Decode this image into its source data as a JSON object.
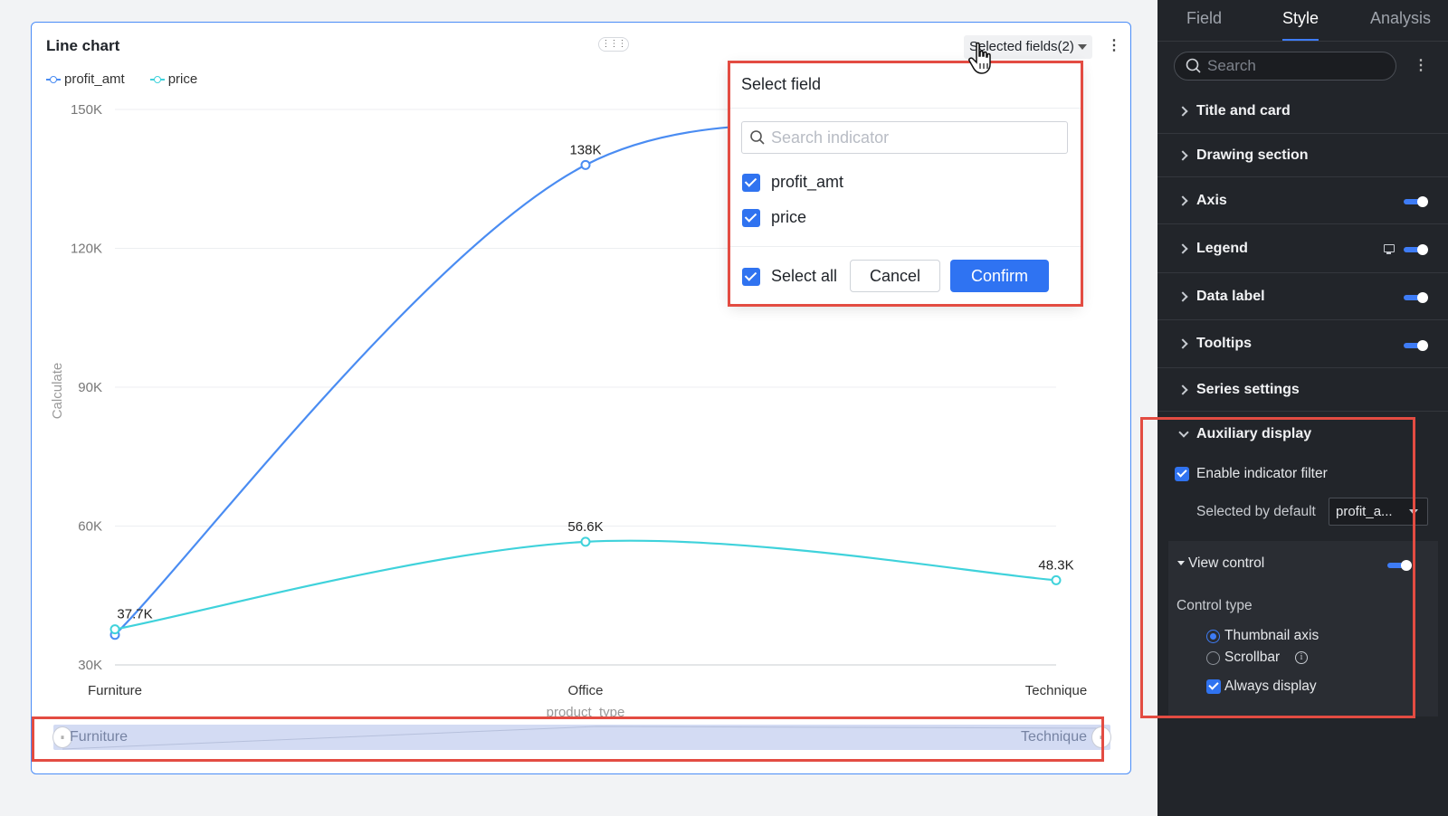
{
  "card": {
    "title": "Line chart",
    "selected_fields_label": "Selected fields(2)"
  },
  "chart_data": {
    "type": "line",
    "title": "Line chart",
    "xlabel": "product_type",
    "ylabel": "Calculate",
    "categories": [
      "Furniture",
      "Office",
      "Technique"
    ],
    "y_ticks": [
      "150K",
      "120K",
      "90K",
      "60K",
      "30K"
    ],
    "ylim": [
      30000,
      150000
    ],
    "legend_position": "top-left",
    "series": [
      {
        "name": "profit_amt",
        "color": "#4a8cf2",
        "values": [
          36500,
          138000,
          141500
        ],
        "labels": [
          null,
          "138K",
          null
        ]
      },
      {
        "name": "price",
        "color": "#3fd2db",
        "values": [
          37700,
          56600,
          48300
        ],
        "labels": [
          "37.7K",
          "56.6K",
          "48.3K"
        ]
      }
    ]
  },
  "thumbnail_axis": {
    "start_label": "Furniture",
    "end_label": "Technique"
  },
  "popover": {
    "title": "Select field",
    "search_placeholder": "Search indicator",
    "fields": [
      {
        "label": "profit_amt",
        "checked": true
      },
      {
        "label": "price",
        "checked": true
      }
    ],
    "select_all_label": "Select all",
    "cancel_label": "Cancel",
    "confirm_label": "Confirm"
  },
  "panel": {
    "tabs": [
      {
        "label": "Field",
        "active": false
      },
      {
        "label": "Style",
        "active": true
      },
      {
        "label": "Analysis",
        "active": false
      }
    ],
    "search_placeholder": "Search",
    "sections": [
      {
        "label": "Title and card",
        "toggle": false
      },
      {
        "label": "Drawing section",
        "toggle": false
      },
      {
        "label": "Axis",
        "toggle": true
      },
      {
        "label": "Legend",
        "toggle": true,
        "icon": "monitor-icon"
      },
      {
        "label": "Data label",
        "toggle": true
      },
      {
        "label": "Tooltips",
        "toggle": true
      },
      {
        "label": "Series settings",
        "toggle": false
      }
    ],
    "auxiliary": {
      "title": "Auxiliary display",
      "enable_filter_label": "Enable indicator filter",
      "selected_by_default_label": "Selected by default",
      "selected_by_default_value": "profit_a...",
      "view_control": {
        "title": "View control",
        "enabled": true,
        "control_type_label": "Control type",
        "options": [
          {
            "label": "Thumbnail axis",
            "selected": true
          },
          {
            "label": "Scrollbar",
            "selected": false
          }
        ],
        "always_display_label": "Always display"
      }
    }
  },
  "colors": {
    "accent": "#2f73f2",
    "highlight": "#e34c42",
    "panel_bg": "#22252a"
  }
}
